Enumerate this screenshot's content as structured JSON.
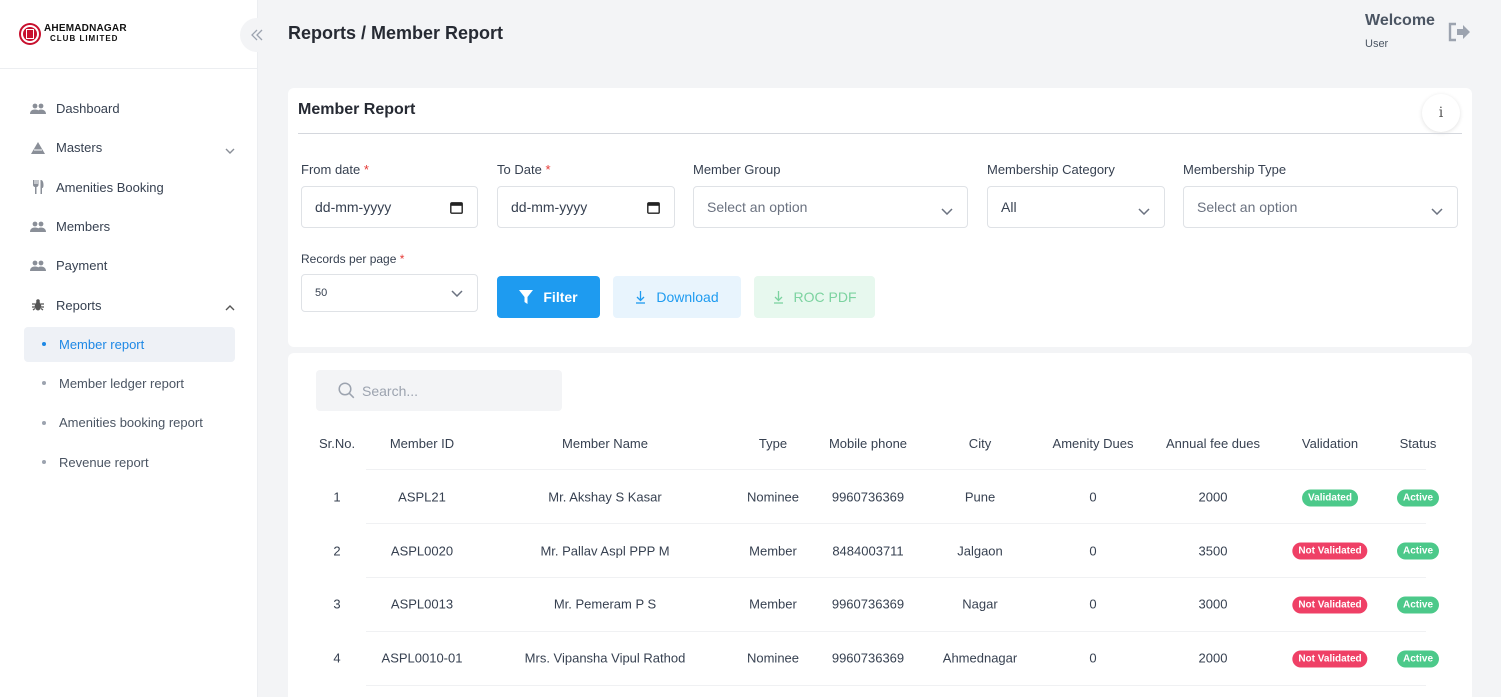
{
  "brand": {
    "line1": "AHEMADNAGAR",
    "line2": "CLUB LIMITED"
  },
  "sidebar": {
    "items": [
      {
        "label": "Dashboard",
        "icon": "users-icon"
      },
      {
        "label": "Masters",
        "icon": "pyramid-icon"
      },
      {
        "label": "Amenities Booking",
        "icon": "fork-knife-icon"
      },
      {
        "label": "Members",
        "icon": "users-icon"
      },
      {
        "label": "Payment",
        "icon": "users-icon"
      },
      {
        "label": "Reports",
        "icon": "bug-icon"
      }
    ],
    "sub_items": [
      {
        "label": "Member report"
      },
      {
        "label": "Member ledger report"
      },
      {
        "label": "Amenities booking report"
      },
      {
        "label": "Revenue report"
      }
    ]
  },
  "header": {
    "breadcrumb": "Reports / Member Report",
    "welcome": "Welcome",
    "user": "User"
  },
  "filter": {
    "title": "Member Report",
    "from_label": "From date",
    "from_value": "dd-mm-yyyy",
    "to_label": "To Date",
    "to_value": "dd-mm-yyyy",
    "group_label": "Member Group",
    "group_placeholder": "Select an option",
    "category_label": "Membership Category",
    "category_value": "All",
    "type_label": "Membership Type",
    "type_placeholder": "Select an option",
    "records_label": "Records per page",
    "records_value": "50",
    "required_mark": "*",
    "filter_btn": "Filter",
    "download_btn": "Download",
    "roc_btn": "ROC PDF",
    "info": "i"
  },
  "table": {
    "search_placeholder": "Search...",
    "columns": [
      "Sr.No.",
      "Member ID",
      "Member Name",
      "Type",
      "Mobile phone",
      "City",
      "Amenity Dues",
      "Annual fee dues",
      "Validation",
      "Status"
    ],
    "rows": [
      {
        "sr": "1",
        "id": "ASPL21",
        "name": "Mr. Akshay S Kasar",
        "type": "Nominee",
        "phone": "9960736369",
        "city": "Pune",
        "amenity": "0",
        "annual": "2000",
        "validation": "Validated",
        "status": "Active"
      },
      {
        "sr": "2",
        "id": "ASPL0020",
        "name": "Mr. Pallav Aspl PPP M",
        "type": "Member",
        "phone": "8484003711",
        "city": "Jalgaon",
        "amenity": "0",
        "annual": "3500",
        "validation": "Not Validated",
        "status": "Active"
      },
      {
        "sr": "3",
        "id": "ASPL0013",
        "name": "Mr. Pemeram P S",
        "type": "Member",
        "phone": "9960736369",
        "city": "Nagar",
        "amenity": "0",
        "annual": "3000",
        "validation": "Not Validated",
        "status": "Active"
      },
      {
        "sr": "4",
        "id": "ASPL0010-01",
        "name": "Mrs. Vipansha Vipul Rathod",
        "type": "Nominee",
        "phone": "9960736369",
        "city": "Ahmednagar",
        "amenity": "0",
        "annual": "2000",
        "validation": "Not Validated",
        "status": "Active"
      }
    ]
  },
  "colors": {
    "accent": "#1e9bf0",
    "validated": "#4cc98a",
    "not_validated": "#ef4066",
    "active": "#4cc98a"
  }
}
